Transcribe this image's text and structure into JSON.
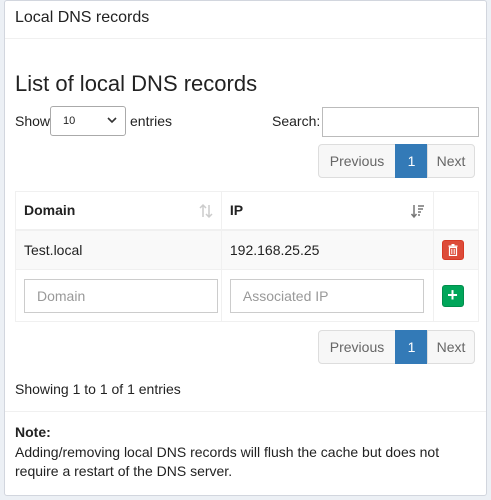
{
  "box": {
    "title": "Local DNS records"
  },
  "list": {
    "title": "List of local DNS records"
  },
  "length": {
    "show_label": "Show",
    "value": "10",
    "entries_label": "entries"
  },
  "search": {
    "label": "Search:",
    "placeholder": "",
    "value": ""
  },
  "pagination": {
    "previous": "Previous",
    "current": "1",
    "next": "Next"
  },
  "table": {
    "headers": {
      "domain": "Domain",
      "ip": "IP"
    },
    "rows": [
      {
        "domain": "Test.local",
        "ip": "192.168.25.25"
      }
    ],
    "add_row": {
      "domain_placeholder": "Domain",
      "ip_placeholder": "Associated IP",
      "add_symbol": "+"
    }
  },
  "info": "Showing 1 to 1 of 1 entries",
  "note": {
    "title": "Note:",
    "text": "Adding/removing local DNS records will flush the cache but does not require a restart of the DNS server."
  },
  "colors": {
    "primary": "#337ab7",
    "danger": "#dd4b39",
    "success": "#00a65a"
  },
  "icons": {
    "delete": "trash-icon",
    "add": "plus-icon",
    "sort_domain": "sort-both-icon",
    "sort_ip": "sort-desc-icon"
  }
}
